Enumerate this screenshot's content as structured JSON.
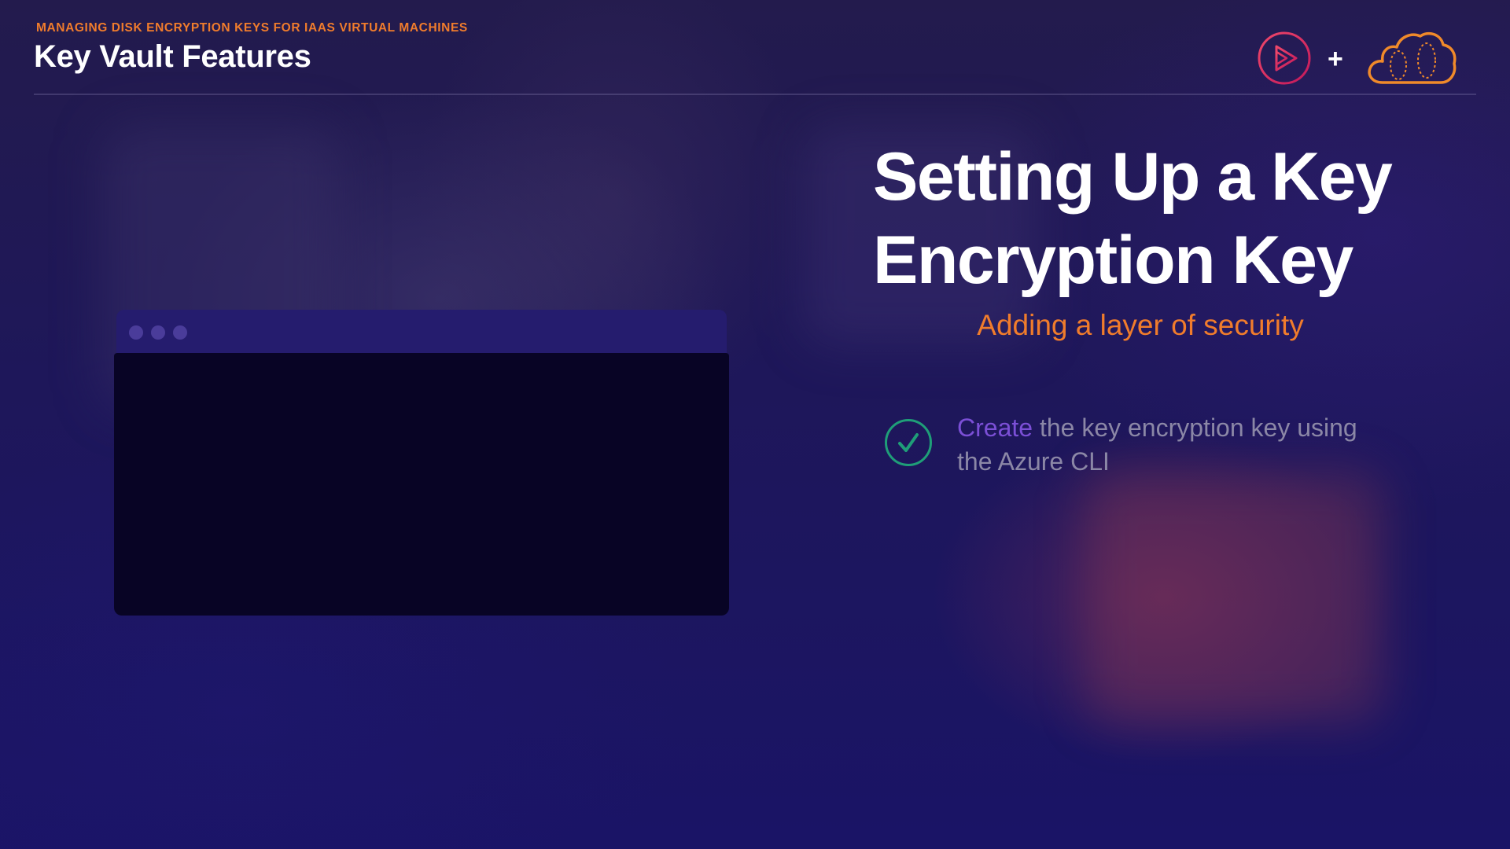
{
  "header": {
    "eyebrow": "MANAGING DISK ENCRYPTION KEYS FOR IAAS VIRTUAL MACHINES",
    "title": "Key Vault Features"
  },
  "logos": {
    "left_icon": "play-icon",
    "separator": "+",
    "right_icon": "cloud-icon"
  },
  "terminal": {
    "dots": 3
  },
  "slide": {
    "title_line_1": "Setting Up a Key",
    "title_line_2": "Encryption Key",
    "subtitle": "Adding a layer of security",
    "bullets": [
      {
        "icon": "check-icon",
        "highlight": "Create",
        "text_line_1": " the key encryption key using",
        "text_line_2": "the Azure CLI"
      }
    ]
  },
  "colors": {
    "accent_orange": "#f07c2c",
    "highlight_purple": "#7b4fd6",
    "check_green": "#1f9e78",
    "play_pink": "#e0245e"
  }
}
